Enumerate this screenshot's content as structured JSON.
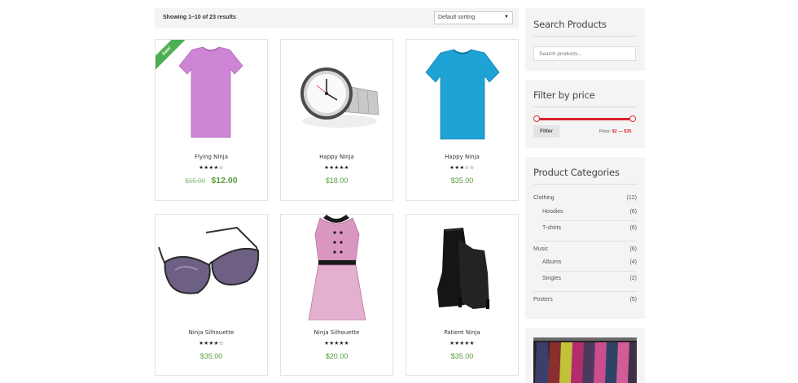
{
  "toolbar": {
    "result_count": "Showing 1–10 of 23 results",
    "sort_selected": "Default sorting"
  },
  "products": [
    {
      "name": "Flying Ninja",
      "stars": "★★★★☆",
      "rating": 4,
      "old_price": "$15.00",
      "price": "$12.00",
      "sale_badge": "Sale!",
      "image": "pink-tshirt"
    },
    {
      "name": "Happy Ninja",
      "stars": "★★★★★",
      "rating": 5,
      "price": "$18.00",
      "image": "wristwatch"
    },
    {
      "name": "Happy Ninja",
      "stars": "★★★☆☆",
      "rating": 3,
      "price": "$35.00",
      "image": "blue-tshirt"
    },
    {
      "name": "Ninja Silhouette",
      "stars": "★★★★☆",
      "rating": 4,
      "price": "$35.00",
      "image": "sunglasses"
    },
    {
      "name": "Ninja Silhouette",
      "stars": "★★★★★",
      "rating": 5,
      "price": "$20.00",
      "image": "pink-dress"
    },
    {
      "name": "Patient Ninja",
      "stars": "★★★★★",
      "rating": 5,
      "price": "$35.00",
      "image": "black-boots"
    }
  ],
  "sidebar": {
    "search": {
      "title": "Search Products",
      "placeholder": "Search products..."
    },
    "price_filter": {
      "title": "Filter by price",
      "button": "Filter",
      "label": "Price:",
      "min": "$2",
      "sep": "—",
      "max": "$35"
    },
    "categories": {
      "title": "Product Categories",
      "items": [
        {
          "name": "Clothing",
          "count": "(12)"
        },
        {
          "name": "Hoodies",
          "count": "(6)"
        },
        {
          "name": "T-shirts",
          "count": "(6)"
        },
        {
          "name": "Music",
          "count": "(6)"
        },
        {
          "name": "Albums",
          "count": "(4)"
        },
        {
          "name": "Singles",
          "count": "(2)"
        },
        {
          "name": "Posters",
          "count": "(5)"
        }
      ]
    }
  },
  "colors": {
    "price": "#5a9e3f",
    "accent": "#d8242f",
    "sale": "#4caf50"
  }
}
